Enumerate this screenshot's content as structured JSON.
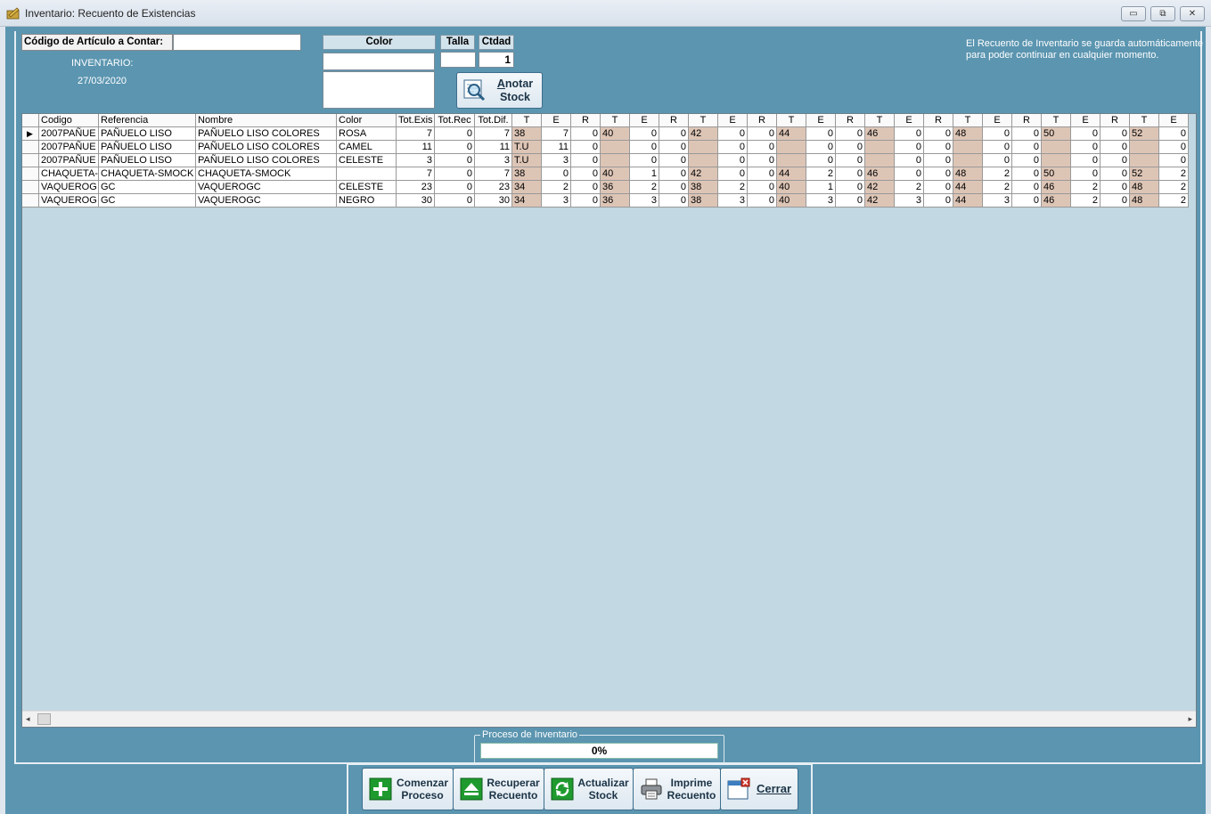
{
  "window": {
    "title": "Inventario: Recuento de Existencias",
    "minimize_glyph": "▭",
    "maximize_glyph": "⧉",
    "close_glyph": "✕"
  },
  "header": {
    "codigo_label": "Código de Artículo a Contar:",
    "codigo_value": "",
    "inventario_label": "INVENTARIO:",
    "inventario_date": "27/03/2020",
    "color_label": "Color",
    "color_value": "",
    "talla_label": "Talla",
    "talla_value": "",
    "ctdad_label": "Ctdad",
    "ctdad_value": "1",
    "anotar_label": "Anotar\nStock",
    "info_text": "El Recuento de Inventario se guarda automáticamente para poder continuar en cualquier momento."
  },
  "grid": {
    "columns": [
      "",
      "Codigo",
      "Referencia",
      "Nombre",
      "Color",
      "Tot.Exis",
      "Tot.Rec",
      "Tot.Dif.",
      "T",
      "E",
      "R",
      "T",
      "E",
      "R",
      "T",
      "E",
      "R",
      "T",
      "E",
      "R",
      "T",
      "E",
      "R",
      "T",
      "E",
      "R",
      "T",
      "E",
      "R",
      "T",
      "E"
    ],
    "current_row_marker": "▶",
    "rows": [
      [
        "2007PAÑUE",
        "PAÑUELO LISO",
        "PAÑUELO LISO COLORES",
        "ROSA",
        "7",
        "0",
        "7",
        "38",
        "7",
        "0",
        "40",
        "0",
        "0",
        "42",
        "0",
        "0",
        "44",
        "0",
        "0",
        "46",
        "0",
        "0",
        "48",
        "0",
        "0",
        "50",
        "0",
        "0",
        "52",
        "0"
      ],
      [
        "2007PAÑUE",
        "PAÑUELO LISO",
        "PAÑUELO LISO COLORES",
        "CAMEL",
        "11",
        "0",
        "11",
        "T.U",
        "11",
        "0",
        "",
        "0",
        "0",
        "",
        "0",
        "0",
        "",
        "0",
        "0",
        "",
        "0",
        "0",
        "",
        "0",
        "0",
        "",
        "0",
        "0",
        "",
        "0"
      ],
      [
        "2007PAÑUE",
        "PAÑUELO LISO",
        "PAÑUELO LISO COLORES",
        "CELESTE",
        "3",
        "0",
        "3",
        "T.U",
        "3",
        "0",
        "",
        "0",
        "0",
        "",
        "0",
        "0",
        "",
        "0",
        "0",
        "",
        "0",
        "0",
        "",
        "0",
        "0",
        "",
        "0",
        "0",
        "",
        "0"
      ],
      [
        "CHAQUETA-",
        "CHAQUETA-SMOCK",
        "CHAQUETA-SMOCK",
        "",
        "7",
        "0",
        "7",
        "38",
        "0",
        "0",
        "40",
        "1",
        "0",
        "42",
        "0",
        "0",
        "44",
        "2",
        "0",
        "46",
        "0",
        "0",
        "48",
        "2",
        "0",
        "50",
        "0",
        "0",
        "52",
        "2"
      ],
      [
        "VAQUEROG",
        "GC",
        "VAQUEROGC",
        "CELESTE",
        "23",
        "0",
        "23",
        "34",
        "2",
        "0",
        "36",
        "2",
        "0",
        "38",
        "2",
        "0",
        "40",
        "1",
        "0",
        "42",
        "2",
        "0",
        "44",
        "2",
        "0",
        "46",
        "2",
        "0",
        "48",
        "2"
      ],
      [
        "VAQUEROG",
        "GC",
        "VAQUEROGC",
        "NEGRO",
        "30",
        "0",
        "30",
        "34",
        "3",
        "0",
        "36",
        "3",
        "0",
        "38",
        "3",
        "0",
        "40",
        "3",
        "0",
        "42",
        "3",
        "0",
        "44",
        "3",
        "0",
        "46",
        "2",
        "0",
        "48",
        "2"
      ]
    ]
  },
  "scrollbar": {
    "left_glyph": "◂",
    "right_glyph": "▸"
  },
  "progress": {
    "legend": "Proceso de Inventario",
    "value_text": "0%",
    "value": 0
  },
  "buttons": {
    "comenzar": "Comenzar\nProceso",
    "recuperar": "Recuperar\nRecuento",
    "actualizar": "Actualizar\nStock",
    "imprime": "Imprime\nRecuento",
    "cerrar": "Cerrar"
  },
  "colors": {
    "panel": "#5b95b0",
    "grid_background": "#c2d8e2",
    "talla_column": "#ddc5b6"
  }
}
